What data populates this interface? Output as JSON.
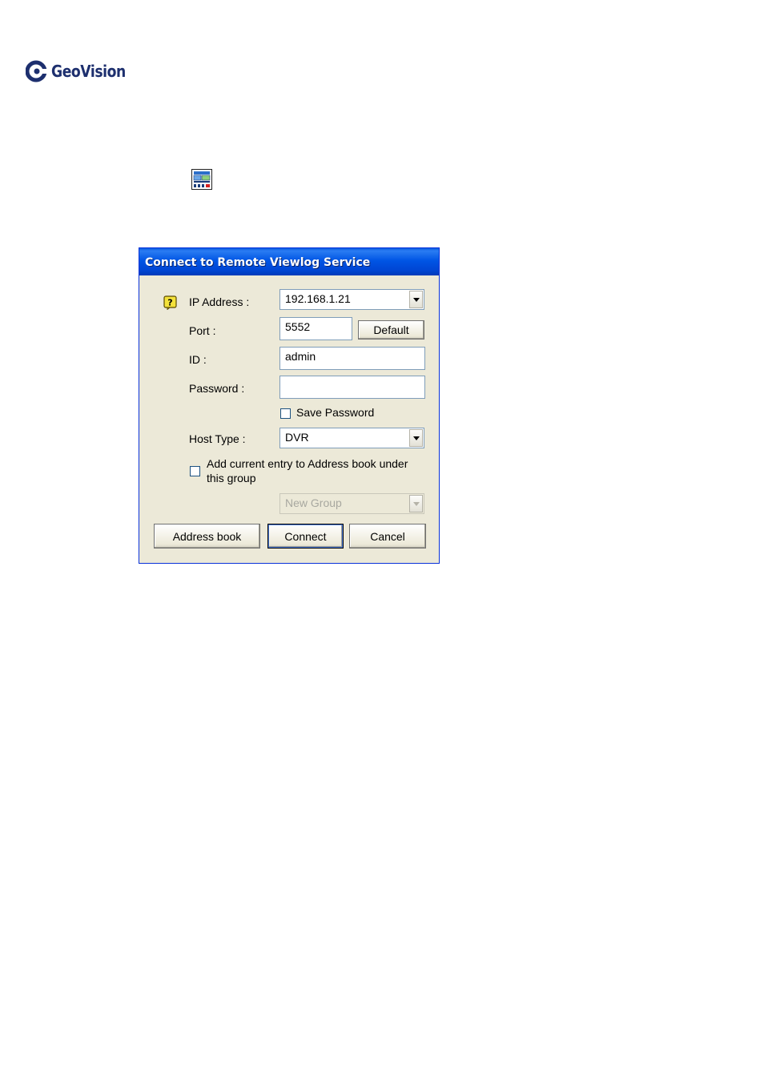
{
  "brand": {
    "name": "GeoVision",
    "mark": "geovision-logo-mark"
  },
  "inline_icon": "viewlog-toolbar-icon",
  "dialog": {
    "title": "Connect to Remote Viewlog Service",
    "help_icon": "help-icon",
    "fields": {
      "ip_address": {
        "label": "IP Address :",
        "value": "192.168.1.21"
      },
      "port": {
        "label": "Port :",
        "value": "5552",
        "default_label": "Default"
      },
      "id": {
        "label": "ID :",
        "value": "admin"
      },
      "password": {
        "label": "Password :",
        "value": ""
      },
      "save_password": {
        "label": "Save Password",
        "checked": false
      },
      "host_type": {
        "label": "Host Type :",
        "value": "DVR"
      },
      "add_entry": {
        "label_line1": "Add current entry to Address book under",
        "label_line2": "this group",
        "checked": false
      },
      "group": {
        "value": "New Group",
        "disabled": true
      }
    },
    "buttons": {
      "address_book": "Address book",
      "connect": "Connect",
      "cancel": "Cancel"
    }
  }
}
